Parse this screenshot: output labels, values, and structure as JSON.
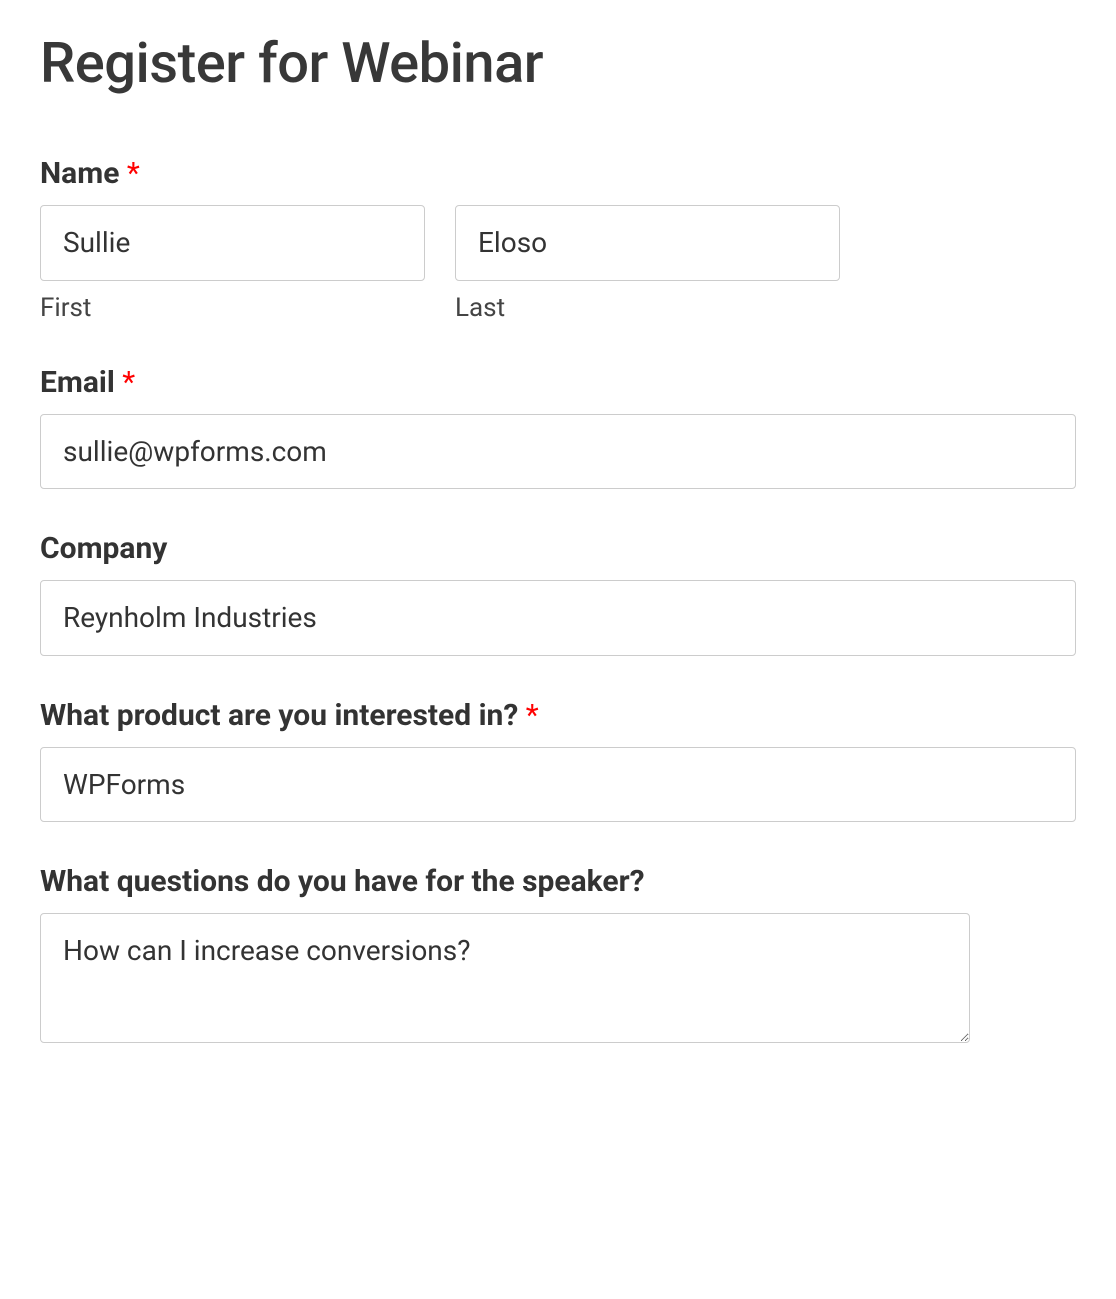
{
  "title": "Register for Webinar",
  "fields": {
    "name": {
      "label": "Name",
      "required": "*",
      "first": {
        "value": "Sullie",
        "sublabel": "First"
      },
      "last": {
        "value": "Eloso",
        "sublabel": "Last"
      }
    },
    "email": {
      "label": "Email",
      "required": "*",
      "value": "sullie@wpforms.com"
    },
    "company": {
      "label": "Company",
      "value": "Reynholm Industries"
    },
    "product": {
      "label": "What product are you interested in?",
      "required": "*",
      "value": "WPForms"
    },
    "questions": {
      "label": "What questions do you have for the speaker?",
      "value": "How can I increase conversions?"
    }
  }
}
